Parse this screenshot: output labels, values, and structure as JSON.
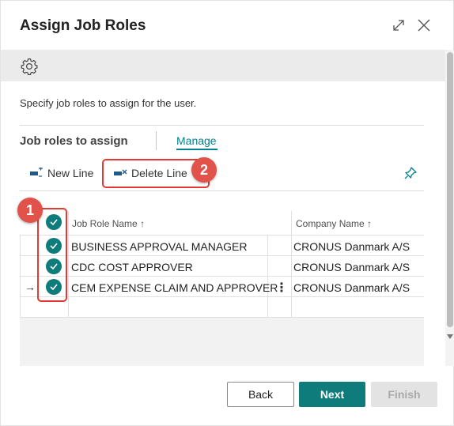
{
  "dialog": {
    "title": "Assign Job Roles",
    "instructions": "Specify job roles to assign for the user."
  },
  "icons": {
    "expand": "expand-icon",
    "close": "close-icon",
    "settings": "gear-icon",
    "new_line": "new-line-icon",
    "delete_line": "delete-line-icon",
    "pin": "pin-icon",
    "checkmark": "checkmark-icon"
  },
  "section": {
    "title": "Job roles to assign",
    "manage_label": "Manage"
  },
  "toolbar": {
    "new_line_label": "New Line",
    "delete_line_label": "Delete Line"
  },
  "grid": {
    "columns": {
      "job_role": "Job Role Name",
      "company": "Company Name",
      "sort_indicator": "↑"
    },
    "rows": [
      {
        "job_role": "BUSINESS APPROVAL MANAGER",
        "company": "CRONUS Danmark A/S",
        "selected": true,
        "current": false
      },
      {
        "job_role": "CDC COST APPROVER",
        "company": "CRONUS Danmark A/S",
        "selected": true,
        "current": false
      },
      {
        "job_role": "CEM EXPENSE CLAIM AND APPROVER",
        "company": "CRONUS Danmark A/S",
        "selected": true,
        "current": true
      }
    ],
    "current_row_marker": "→",
    "row_actions": "⋮"
  },
  "callouts": {
    "one": "1",
    "two": "2"
  },
  "buttons": {
    "back": "Back",
    "next": "Next",
    "finish": "Finish"
  },
  "colors": {
    "accent": "#0e7c7b",
    "link": "#00838f",
    "callout": "#e53935"
  }
}
